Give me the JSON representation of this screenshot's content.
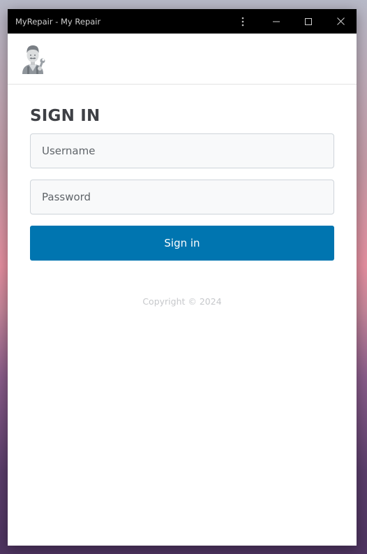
{
  "window": {
    "title": "MyRepair - My Repair"
  },
  "header": {
    "logo_icon": "mechanic-avatar-icon"
  },
  "login": {
    "heading": "SIGN IN",
    "username_placeholder": "Username",
    "username_value": "",
    "password_placeholder": "Password",
    "password_value": "",
    "submit_label": "Sign in"
  },
  "footer": {
    "copyright": "Copyright © 2024"
  },
  "colors": {
    "primary_button": "#0075b0",
    "titlebar": "#000000",
    "heading": "#3e4045"
  }
}
